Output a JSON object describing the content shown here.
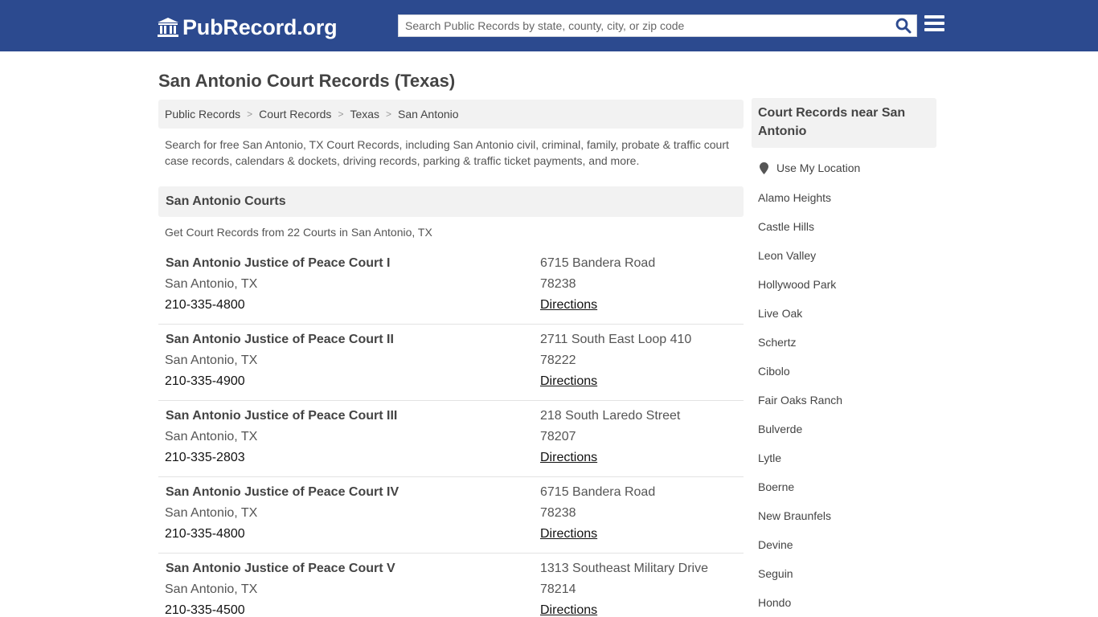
{
  "header": {
    "logo_text": "PubRecord.org",
    "search_placeholder": "Search Public Records by state, county, city, or zip code"
  },
  "page_title": "San Antonio Court Records (Texas)",
  "breadcrumb": [
    "Public Records",
    "Court Records",
    "Texas",
    "San Antonio"
  ],
  "intro": "Search for free San Antonio, TX Court Records, including San Antonio civil, criminal, family, probate & traffic court case records, calendars & dockets, driving records, parking & traffic ticket payments, and more.",
  "courts_section": {
    "title": "San Antonio Courts",
    "subtitle": "Get Court Records from 22 Courts in San Antonio, TX"
  },
  "courts": [
    {
      "name": "San Antonio Justice of Peace Court I",
      "city": "San Antonio, TX",
      "phone": "210-335-4800",
      "street": "6715 Bandera Road",
      "zip": "78238",
      "directions": "Directions"
    },
    {
      "name": "San Antonio Justice of Peace Court II",
      "city": "San Antonio, TX",
      "phone": "210-335-4900",
      "street": "2711 South East Loop 410",
      "zip": "78222",
      "directions": "Directions"
    },
    {
      "name": "San Antonio Justice of Peace Court III",
      "city": "San Antonio, TX",
      "phone": "210-335-2803",
      "street": "218 South Laredo Street",
      "zip": "78207",
      "directions": "Directions"
    },
    {
      "name": "San Antonio Justice of Peace Court IV",
      "city": "San Antonio, TX",
      "phone": "210-335-4800",
      "street": "6715 Bandera Road",
      "zip": "78238",
      "directions": "Directions"
    },
    {
      "name": "San Antonio Justice of Peace Court V",
      "city": "San Antonio, TX",
      "phone": "210-335-4500",
      "street": "1313 Southeast Military Drive",
      "zip": "78214",
      "directions": "Directions"
    }
  ],
  "sidebar": {
    "title": "Court Records near San Antonio",
    "use_location": "Use My Location",
    "nearby": [
      "Alamo Heights",
      "Castle Hills",
      "Leon Valley",
      "Hollywood Park",
      "Live Oak",
      "Schertz",
      "Cibolo",
      "Fair Oaks Ranch",
      "Bulverde",
      "Lytle",
      "Boerne",
      "New Braunfels",
      "Devine",
      "Seguin",
      "Hondo"
    ]
  },
  "colors": {
    "navbar": "#2c4a8f",
    "search_icon": "#2c4a8f",
    "panel_bg": "#f2f2f2"
  }
}
